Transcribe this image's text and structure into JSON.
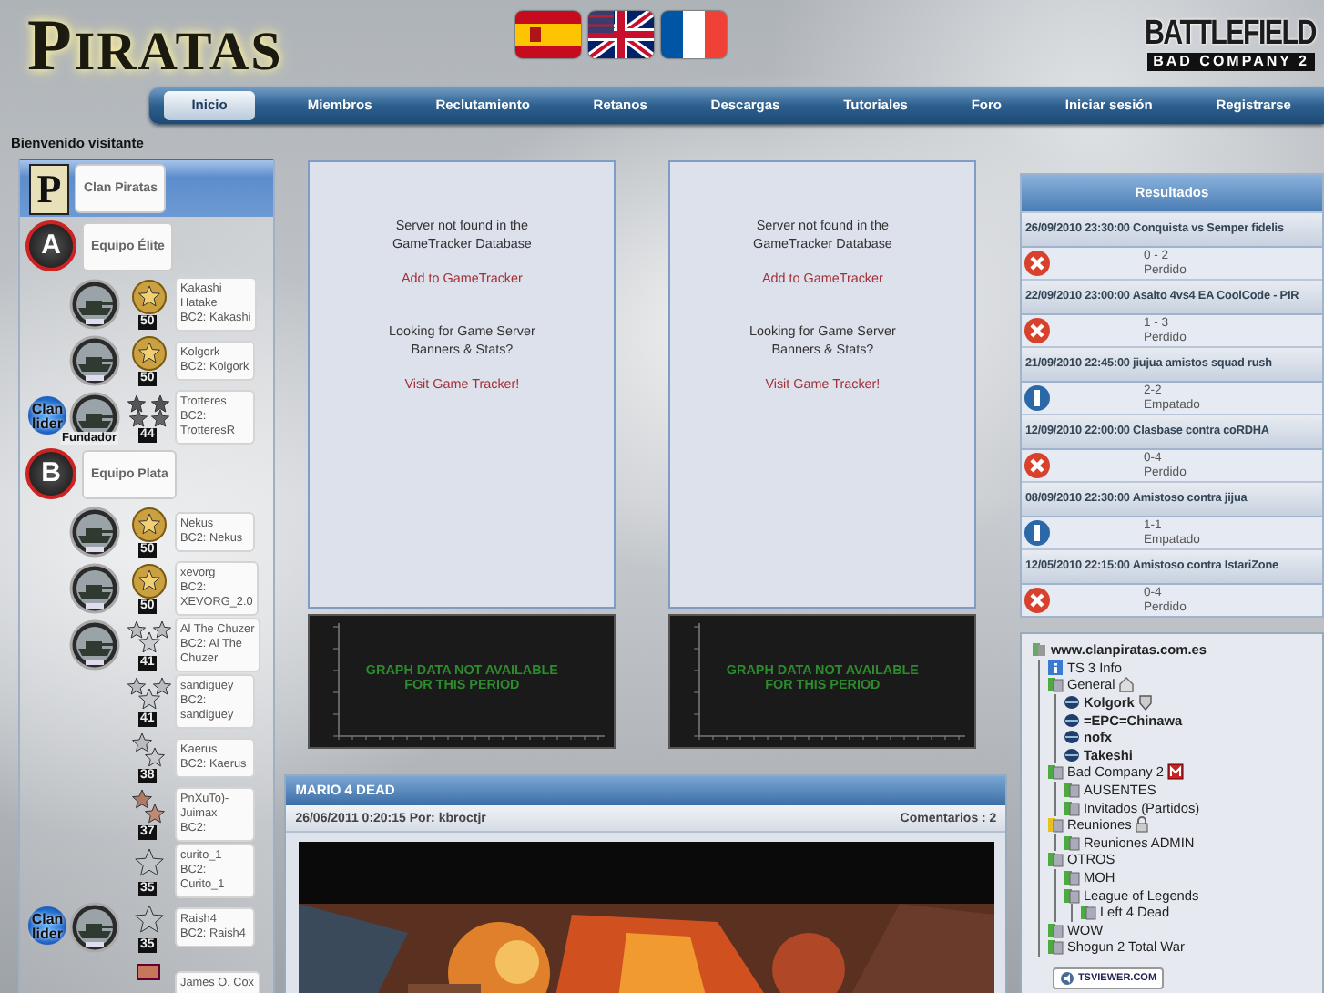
{
  "header": {
    "logo": "PIRATAS",
    "game_title": "BATTLEFIELD",
    "game_subtitle": "BAD COMPANY 2"
  },
  "nav": [
    {
      "label": "Inicio",
      "selected": true
    },
    {
      "label": "Miembros",
      "selected": false
    },
    {
      "label": "Reclutamiento",
      "selected": false
    },
    {
      "label": "Retanos",
      "selected": false
    },
    {
      "label": "Descargas",
      "selected": false
    },
    {
      "label": "Tutoriales",
      "selected": false
    },
    {
      "label": "Foro",
      "selected": false
    },
    {
      "label": "Iniciar sesión",
      "selected": false
    },
    {
      "label": "Registrarse",
      "selected": false
    }
  ],
  "welcome": "Bienvenido visitante",
  "roster": [
    {
      "kind": "group",
      "badge": {
        "kind": "logo",
        "letter": "P"
      },
      "label": "Clan Piratas",
      "selected": true
    },
    {
      "kind": "group",
      "badge": {
        "kind": "circle",
        "letter": "A"
      },
      "label": "Equipo Élite",
      "selected": false
    },
    {
      "kind": "member",
      "card": "Kakashi\nHatake\nBC2: Kakashi",
      "emblem": true,
      "rank": {
        "kind": "gold",
        "number": "50"
      }
    },
    {
      "kind": "member",
      "card": "Kolgork\nBC2: Kolgork",
      "emblem": true,
      "rank": {
        "kind": "gold",
        "number": "50"
      }
    },
    {
      "kind": "member",
      "card": "Trotteres\nBC2:\nTrotteresR",
      "emblem": true,
      "emblem_caption": "Fundador",
      "leader_badge": "Clan\nlider",
      "rank": {
        "kind": "wings",
        "number": "44"
      }
    },
    {
      "kind": "group",
      "badge": {
        "kind": "circle",
        "letter": "B"
      },
      "label": "Equipo Plata",
      "selected": false
    },
    {
      "kind": "member",
      "card": "Nekus\nBC2: Nekus",
      "emblem": true,
      "rank": {
        "kind": "gold",
        "number": "50"
      }
    },
    {
      "kind": "member",
      "card": "xevorg\nBC2:\nXEVORG_2.0",
      "emblem": true,
      "rank": {
        "kind": "gold",
        "number": "50"
      }
    },
    {
      "kind": "member",
      "card": "Al The Chuzer\nBC2: Al The\nChuzer",
      "emblem": true,
      "rank": {
        "kind": "stars3",
        "number": "41"
      }
    },
    {
      "kind": "member",
      "card": "sandiguey\nBC2:\nsandiguey",
      "emblem": false,
      "rank": {
        "kind": "stars3",
        "number": "41"
      }
    },
    {
      "kind": "member",
      "card": "Kaerus\nBC2: Kaerus",
      "emblem": false,
      "rank": {
        "kind": "stars2",
        "number": "38"
      }
    },
    {
      "kind": "member",
      "card": "PnXuTo)-\nJuimax\nBC2:",
      "emblem": false,
      "rank": {
        "kind": "bronze",
        "number": "37"
      }
    },
    {
      "kind": "member",
      "card": "curito_1\nBC2:\nCurito_1",
      "emblem": false,
      "rank": {
        "kind": "star",
        "number": "35"
      }
    },
    {
      "kind": "member",
      "card": "Raish4\nBC2: Raish4",
      "emblem": true,
      "leader_badge": "Clan\nlider",
      "rank": {
        "kind": "star",
        "number": "35"
      }
    },
    {
      "kind": "member",
      "card": "James O. Cox",
      "emblem": false,
      "rank": {
        "kind": "bar"
      }
    }
  ],
  "trackers": [
    {
      "message": "Server not found in the\nGameTracker Database",
      "add_link": "Add to GameTracker",
      "promo": "Looking for Game Server\nBanners & Stats?",
      "visit_link": "Visit Game Tracker!",
      "graph_message": "GRAPH DATA NOT AVAILABLE\nFOR THIS PERIOD"
    },
    {
      "message": "Server not found in the\nGameTracker Database",
      "add_link": "Add to GameTracker",
      "promo": "Looking for Game Server\nBanners & Stats?",
      "visit_link": "Visit Game Tracker!",
      "graph_message": "GRAPH DATA NOT AVAILABLE\nFOR THIS PERIOD"
    }
  ],
  "news": {
    "title": "MARIO 4 DEAD",
    "meta": "26/06/2011 0:20:15 Por: kbroctjr",
    "comments": "Comentarios : 2"
  },
  "results": {
    "title": "Resultados",
    "matches": [
      {
        "title": "26/09/2010 23:30:00 Conquista vs Semper fidelis",
        "score": "0 - 2",
        "status": "Perdido",
        "kind": "lost"
      },
      {
        "title": "22/09/2010 23:00:00 Asalto 4vs4 EA CoolCode - PIR",
        "score": "1 - 3",
        "status": "Perdido",
        "kind": "lost"
      },
      {
        "title": "21/09/2010 22:45:00 jiujua amistos squad rush",
        "score": "2-2",
        "status": "Empatado",
        "kind": "draw"
      },
      {
        "title": "12/09/2010 22:00:00 Clasbase contra coRDHA",
        "score": "0-4",
        "status": "Perdido",
        "kind": "lost"
      },
      {
        "title": "08/09/2010 22:30:00 Amistoso contra jijua",
        "score": "1-1",
        "status": "Empatado",
        "kind": "draw"
      },
      {
        "title": "12/05/2010 22:15:00 Amistoso contra IstariZone",
        "score": "0-4",
        "status": "Perdido",
        "kind": "lost"
      }
    ]
  },
  "teamspeak": {
    "footer": "TSVIEWER.COM",
    "tree": [
      {
        "label": "www.clanpiratas.com.es",
        "kind": "server",
        "children": [
          {
            "label": "TS 3 Info",
            "kind": "info"
          },
          {
            "label": "General",
            "kind": "channel",
            "marker": {
              "kind": "home"
            },
            "children": [
              {
                "label": "Kolgork",
                "kind": "user",
                "marker": {
                  "kind": "admin"
                }
              },
              {
                "label": "=EPC=Chinawa",
                "kind": "user"
              },
              {
                "label": "nofx",
                "kind": "user"
              },
              {
                "label": "Takeshi",
                "kind": "user"
              }
            ]
          },
          {
            "label": "Bad Company 2",
            "kind": "channel",
            "marker": {
              "kind": "moderated"
            },
            "children": [
              {
                "label": "AUSENTES",
                "kind": "channel"
              },
              {
                "label": "Invitados (Partidos)",
                "kind": "channel"
              }
            ]
          },
          {
            "label": "Reuniones",
            "kind": "channel",
            "marker": {
              "kind": "password"
            },
            "children": [
              {
                "label": "Reuniones ADMIN",
                "kind": "channel"
              }
            ]
          },
          {
            "label": "OTROS",
            "kind": "channel",
            "children": [
              {
                "label": "MOH",
                "kind": "channel"
              },
              {
                "label": "League of Legends",
                "kind": "channel",
                "children": [
                  {
                    "label": "Left 4 Dead",
                    "kind": "channel"
                  }
                ]
              }
            ]
          },
          {
            "label": "WOW",
            "kind": "channel"
          },
          {
            "label": "Shogun 2 Total War",
            "kind": "channel"
          }
        ]
      }
    ]
  }
}
